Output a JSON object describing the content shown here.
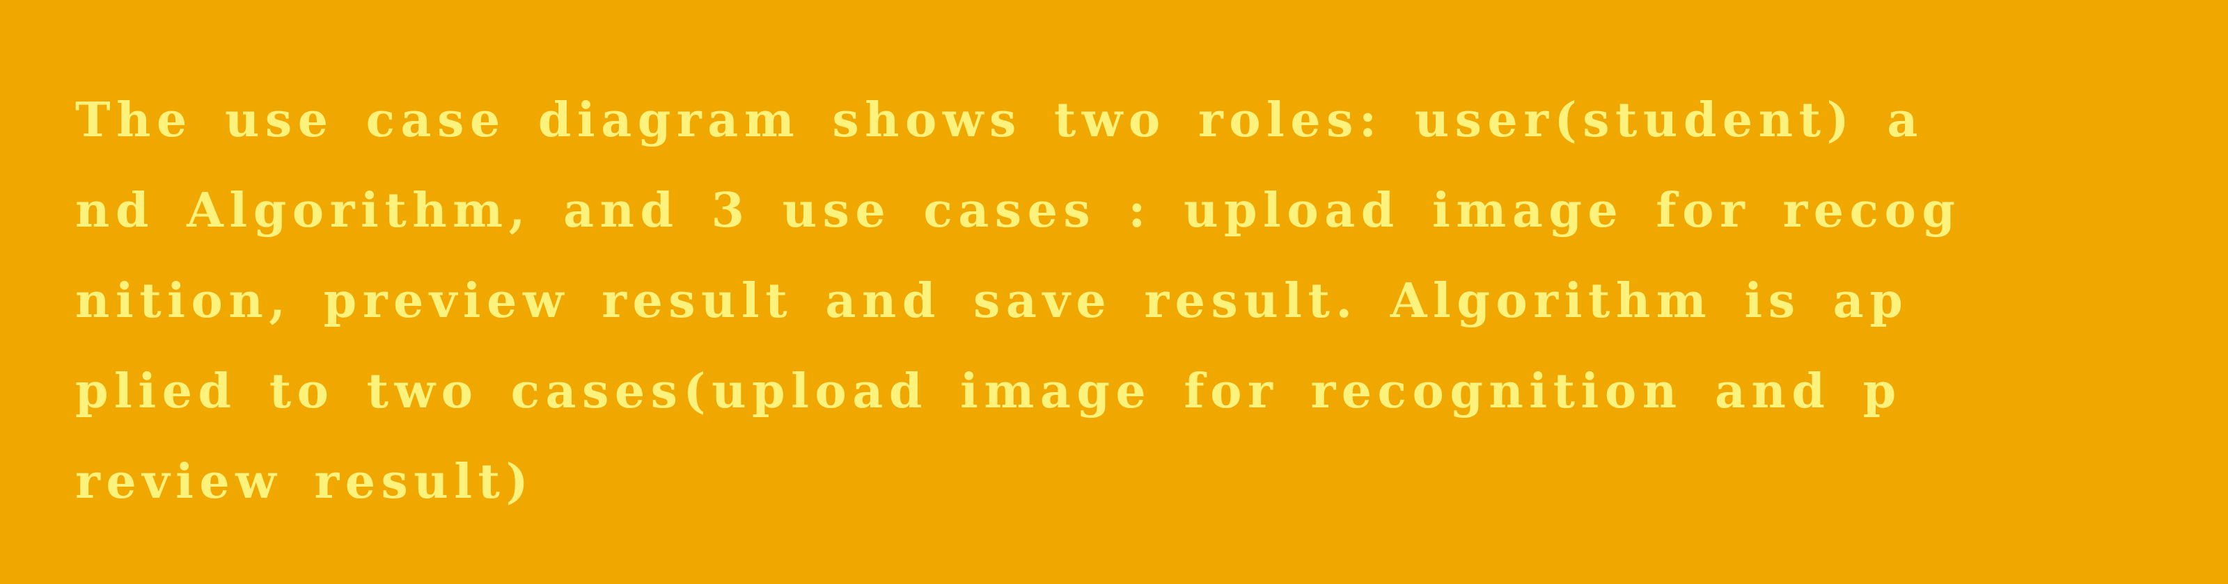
{
  "background_color": "#f0a800",
  "text_color": "#fdf27c",
  "lines": [
    "The use case diagram shows two roles: user(student) a",
    "nd Algorithm, and 3 use cases : upload image for recog",
    "nition, preview result and save result. Algorithm is ap",
    "plied to two cases(upload image for recognition and p",
    "review result)"
  ]
}
